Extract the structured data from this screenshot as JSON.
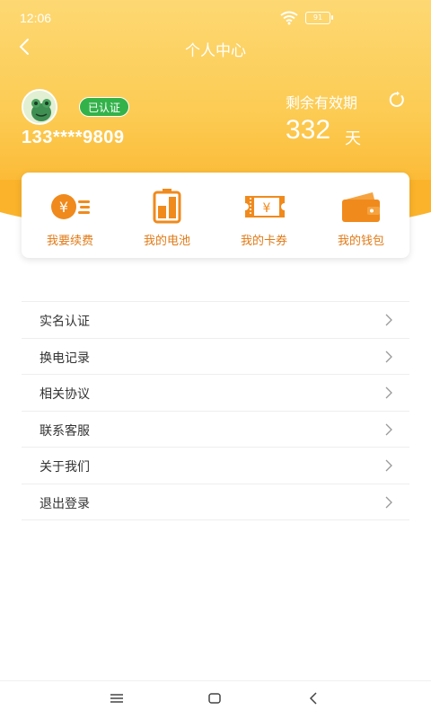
{
  "status_bar": {
    "time": "12:06",
    "battery": "91"
  },
  "nav": {
    "title": "个人中心"
  },
  "profile": {
    "verified_label": "已认证",
    "phone": "133****9809",
    "validity_label": "剩余有效期",
    "validity_days": "332",
    "validity_unit": "天"
  },
  "quick_actions": [
    {
      "label": "我要续费",
      "icon": "renew-coin-icon"
    },
    {
      "label": "我的电池",
      "icon": "battery-icon"
    },
    {
      "label": "我的卡券",
      "icon": "coupon-icon"
    },
    {
      "label": "我的钱包",
      "icon": "wallet-icon"
    }
  ],
  "menu": [
    {
      "label": "实名认证"
    },
    {
      "label": "换电记录"
    },
    {
      "label": "相关协议"
    },
    {
      "label": "联系客服"
    },
    {
      "label": "关于我们"
    },
    {
      "label": "退出登录"
    }
  ],
  "colors": {
    "header_gradient_top": "#fdd873",
    "header_gradient_bottom": "#fbb32b",
    "accent_orange": "#e07a16",
    "verified_green": "#33b24a"
  }
}
